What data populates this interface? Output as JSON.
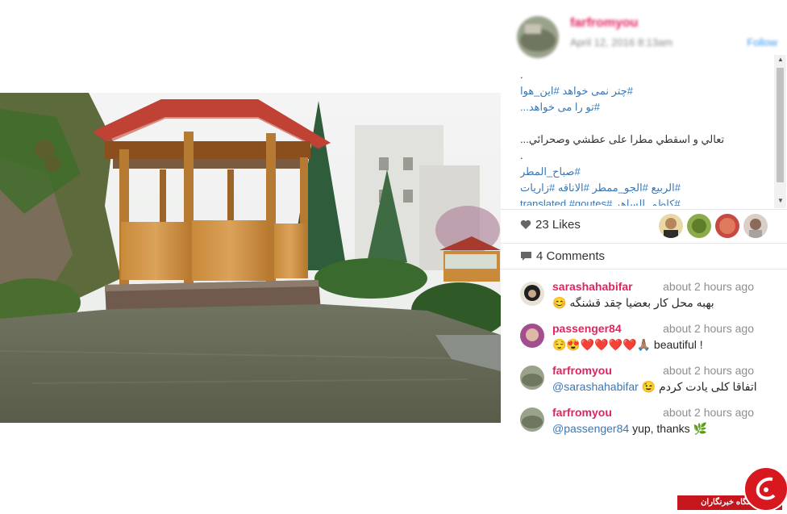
{
  "post": {
    "username": "farfromyou",
    "date": "April 12, 2016 8:13am",
    "follow_label": "Follow"
  },
  "caption": {
    "lines": [
      ".",
      "#چتر نمی خواهد #این_هوا",
      "#تو را می خواهد...",
      "",
      "تعالي و اسقطي مطرا على عطشي وصحرائي...",
      ".",
      "#صباح_المطر",
      "#الربيع #الجو_ممطر #الاناقه #زاريات",
      "#كاظم_الساهر #translated #qoutes"
    ]
  },
  "likes": {
    "count_label": "23 Likes"
  },
  "comments_count": {
    "label": "4 Comments"
  },
  "comments": [
    {
      "user": "sarashahabifar",
      "time": "about 2 hours ago",
      "text": "😊 بهبه محل کار بعضیا چقد قشنگه"
    },
    {
      "user": "passenger84",
      "time": "about 2 hours ago",
      "text": "😌😍❤️❤️❤️❤️🙏🏽 beautiful !"
    },
    {
      "user": "farfromyou",
      "time": "about 2 hours ago",
      "mention": "@sarashahabifar",
      "text": "😉 اتفاقا کلی یادت کردم"
    },
    {
      "user": "farfromyou",
      "time": "about 2 hours ago",
      "mention": "@passenger84",
      "text": "yup, thanks 🌿"
    }
  ],
  "watermark": {
    "text": "باشگاه خبرنگاران"
  },
  "colors": {
    "username": "#e0245e",
    "hashtag": "#3a77b3",
    "time": "#8e8e8e",
    "watermark": "#c4161c"
  },
  "icons": [
    "heart-icon",
    "comment-bubble-icon",
    "scroll-up-icon",
    "scroll-down-icon"
  ]
}
